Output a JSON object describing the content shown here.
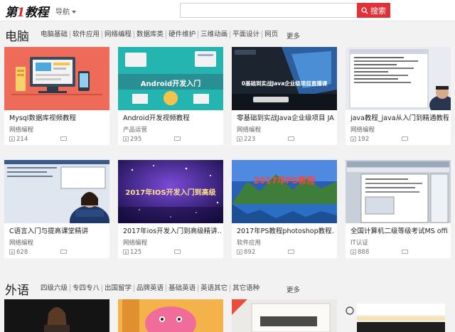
{
  "header": {
    "logo_prefix": "第",
    "logo_num": "1",
    "logo_suffix": "教程",
    "nav_label": "导航",
    "search_placeholder": "",
    "search_button": "搜索"
  },
  "sections": [
    {
      "title": "电脑",
      "categories": [
        "电脑基础",
        "软件应用",
        "网络编程",
        "数据库类",
        "硬件维护",
        "三维动画",
        "平面设计",
        "网页"
      ],
      "more": "更多",
      "cards": [
        {
          "title": "Mysql数据库视频教程",
          "category": "网络编程",
          "views": "214"
        },
        {
          "title": "Android开发视频教程",
          "category": "产品运营",
          "views": "295",
          "thumb_text": "Android开发入门"
        },
        {
          "title": "零基础到实战Java企业级项目 JA…",
          "category": "网络编程",
          "views": "223",
          "thumb_text": "0基础到实战Java企业级项目直播课"
        },
        {
          "title": "java教程_java从入门到精通教程…",
          "category": "网络编程",
          "views": "192"
        },
        {
          "title": "C语言入门与提高课堂精讲",
          "category": "网络编程",
          "views": "628"
        },
        {
          "title": "2017年ios开发入门到高级精讲…",
          "category": "网络编程",
          "views": "125",
          "thumb_text": "2017年IOS开发入门到高级"
        },
        {
          "title": "2017年PS教程photoshop教程…",
          "category": "软件应用",
          "views": "892",
          "thumb_text": "2017年PS教程"
        },
        {
          "title": "全国计算机二级等级考试MS offi…",
          "category": "IT认证",
          "views": "888"
        }
      ]
    },
    {
      "title": "外语",
      "categories": [
        "四级六级",
        "专四专八",
        "出国留学",
        "品牌英语",
        "基础英语",
        "英语其它",
        "其它语种"
      ],
      "more": "更多"
    }
  ],
  "colors": {
    "accent": "#e0313a",
    "background": "#f2f2f2"
  }
}
